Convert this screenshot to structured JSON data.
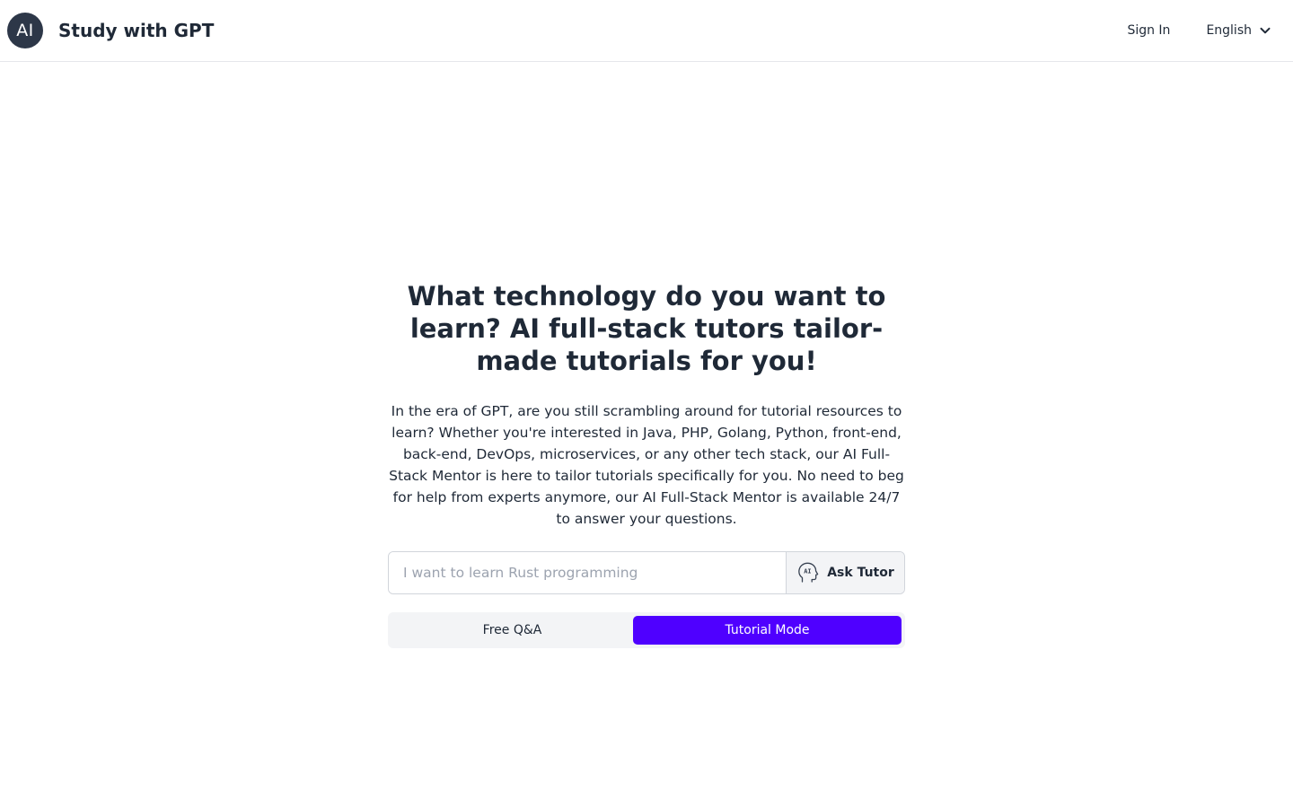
{
  "header": {
    "logo_text": "AI",
    "brand_title": "Study with GPT",
    "sign_in_label": "Sign In",
    "language_selected": "English",
    "language_icon": "chevron-down-icon"
  },
  "hero": {
    "title": "What technology do you want to learn? AI full-stack tutors tailor-made tutorials for you!",
    "description": "In the era of GPT, are you still scrambling around for tutorial resources to learn? Whether you're interested in Java, PHP, Golang, Python, front-end, back-end, DevOps, microservices, or any other tech stack, our AI Full-Stack Mentor is here to tailor tutorials specifically for you. No need to beg for help from experts anymore, our AI Full-Stack Mentor is available 24/7 to answer your questions."
  },
  "ask": {
    "placeholder": "I want to learn Rust programming",
    "value": "",
    "button_label": "Ask Tutor",
    "button_icon": "ai-head-icon"
  },
  "modes": {
    "free_label": "Free Q&A",
    "tutorial_label": "Tutorial Mode",
    "selected": "Tutorial Mode"
  },
  "colors": {
    "accent": "#4f00ff",
    "logo_bg": "#2d3748",
    "text": "#1f2937"
  }
}
